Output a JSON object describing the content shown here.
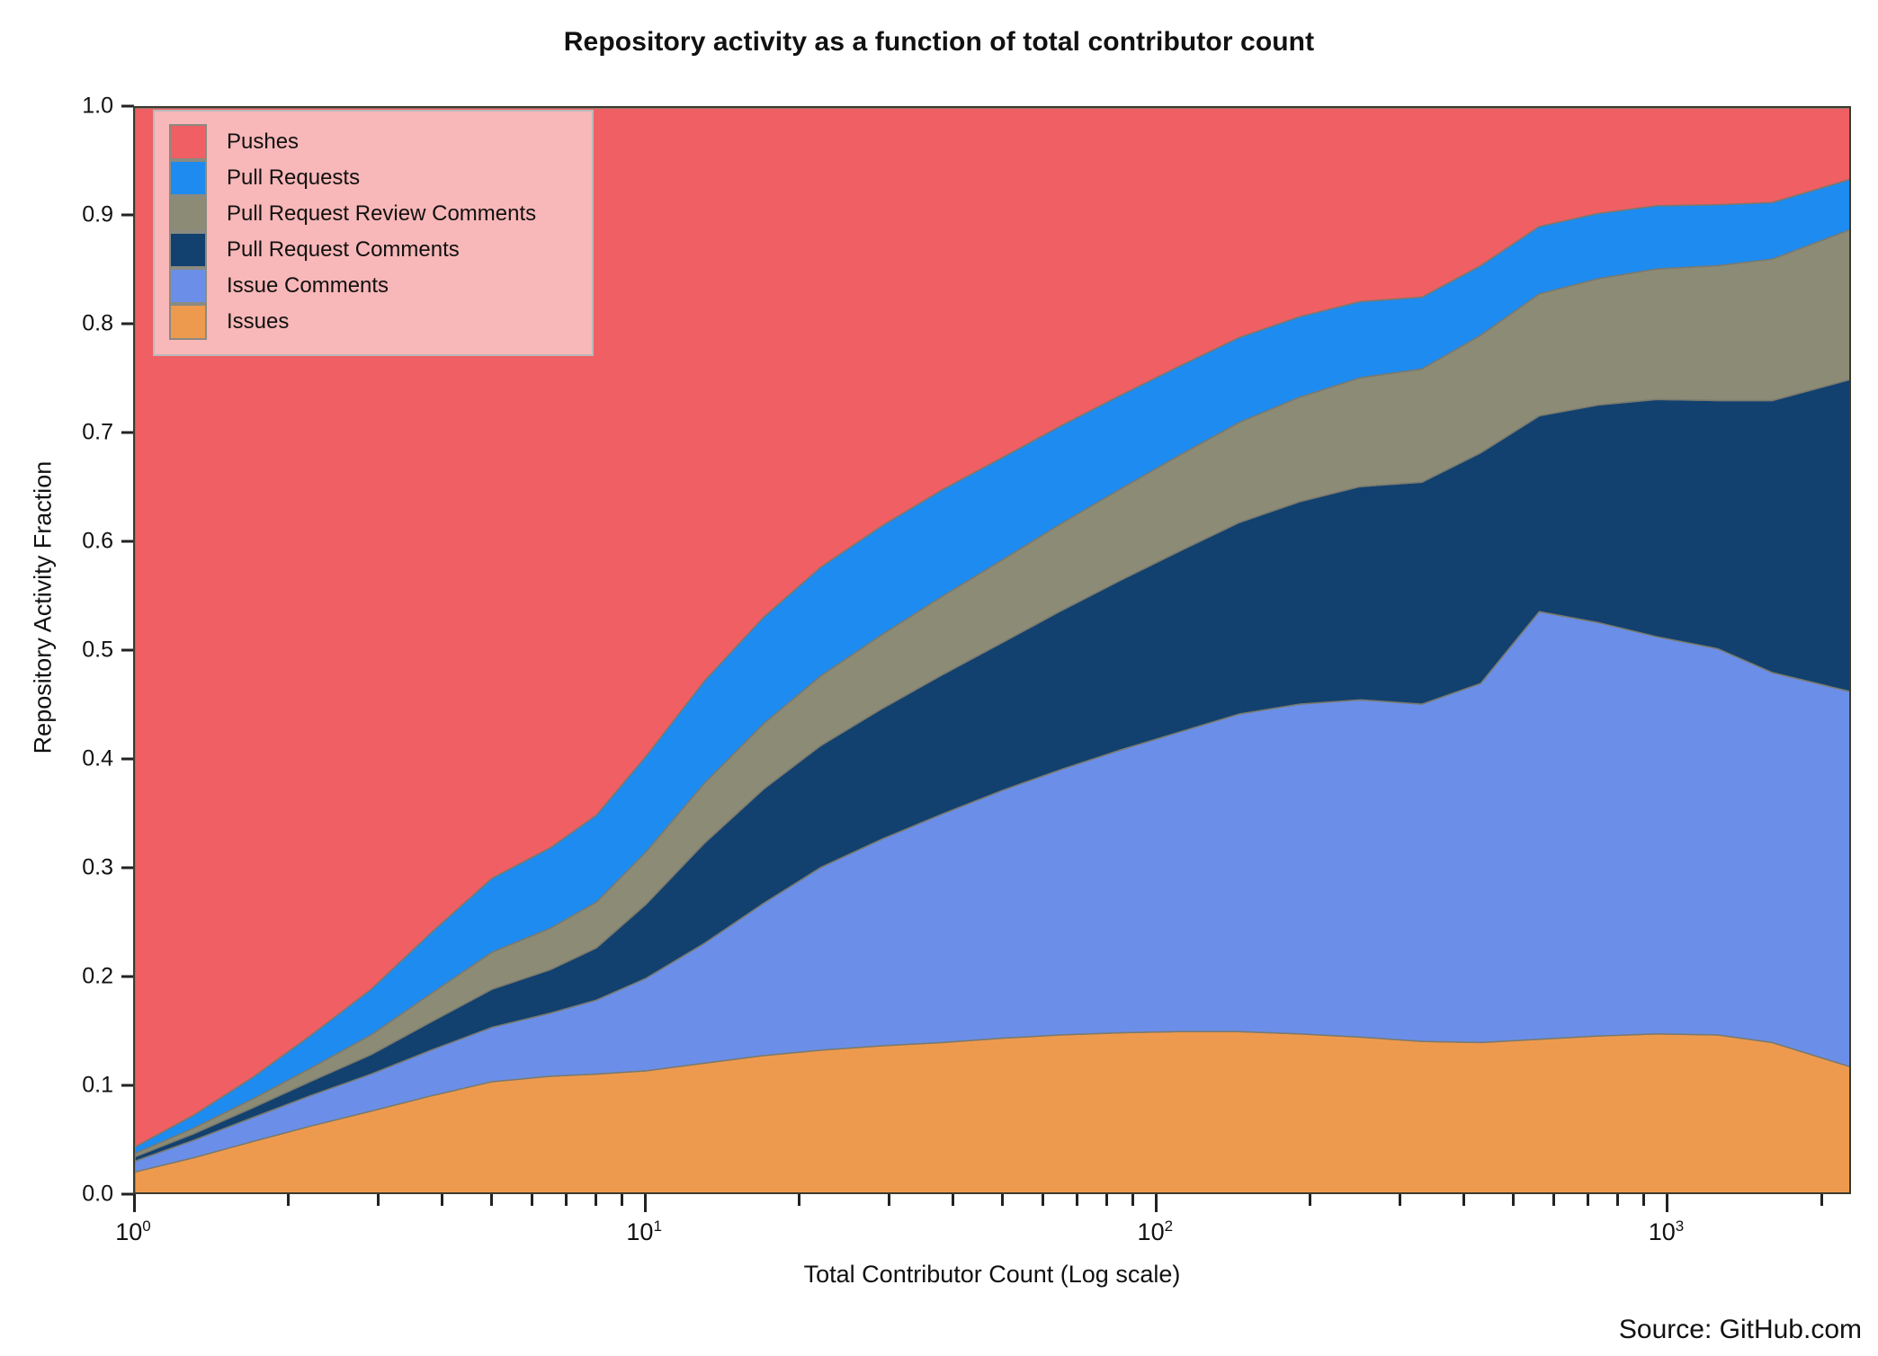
{
  "chart_data": {
    "type": "area",
    "title": "Repository activity as a function of total contributor count",
    "xlabel": "Total Contributor Count (Log scale)",
    "ylabel": "Repository Activity Fraction",
    "source": "Source: GitHub.com",
    "xscale": "log",
    "xlim": [
      1,
      2300
    ],
    "ylim": [
      0,
      1
    ],
    "grid": false,
    "stacked": true,
    "legend_position": "upper-left",
    "ytick_labels": [
      "0.0",
      "0.1",
      "0.2",
      "0.3",
      "0.4",
      "0.5",
      "0.6",
      "0.7",
      "0.8",
      "0.9",
      "1.0"
    ],
    "ytick_values": [
      0.0,
      0.1,
      0.2,
      0.3,
      0.4,
      0.5,
      0.6,
      0.7,
      0.8,
      0.9,
      1.0
    ],
    "xtick_labels": [
      "10⁰",
      "10¹",
      "10²",
      "10³"
    ],
    "xtick_values": [
      1,
      10,
      100,
      1000
    ],
    "xtick_exponents": [
      "0",
      "1",
      "2",
      "3"
    ],
    "x": [
      1,
      1.3,
      1.7,
      2.2,
      2.9,
      3.8,
      5,
      6.5,
      8,
      10,
      13,
      17,
      22,
      29,
      38,
      50,
      65,
      85,
      110,
      145,
      190,
      250,
      330,
      430,
      560,
      730,
      950,
      1250,
      1600,
      2300
    ],
    "series": [
      {
        "name": "Issues",
        "color": "#EE9A4E",
        "values": [
          0.022,
          0.035,
          0.05,
          0.064,
          0.078,
          0.092,
          0.105,
          0.11,
          0.112,
          0.115,
          0.122,
          0.129,
          0.134,
          0.138,
          0.141,
          0.145,
          0.148,
          0.15,
          0.151,
          0.151,
          0.149,
          0.146,
          0.142,
          0.141,
          0.144,
          0.147,
          0.149,
          0.148,
          0.141,
          0.118
        ]
      },
      {
        "name": "Issue Comments",
        "color": "#6B8FE8",
        "values": [
          0.01,
          0.016,
          0.022,
          0.028,
          0.034,
          0.042,
          0.05,
          0.058,
          0.068,
          0.085,
          0.11,
          0.14,
          0.168,
          0.19,
          0.21,
          0.228,
          0.244,
          0.26,
          0.275,
          0.292,
          0.303,
          0.31,
          0.31,
          0.33,
          0.393,
          0.38,
          0.365,
          0.355,
          0.34,
          0.345
        ]
      },
      {
        "name": "Pull Request Comments",
        "color": "#12416F",
        "values": [
          0.004,
          0.006,
          0.009,
          0.013,
          0.018,
          0.026,
          0.035,
          0.04,
          0.048,
          0.068,
          0.092,
          0.105,
          0.112,
          0.12,
          0.128,
          0.136,
          0.146,
          0.156,
          0.166,
          0.176,
          0.186,
          0.196,
          0.204,
          0.212,
          0.18,
          0.2,
          0.218,
          0.228,
          0.25,
          0.288
        ]
      },
      {
        "name": "Pull Request Review Comments",
        "color": "#8C8B76",
        "values": [
          0.003,
          0.005,
          0.008,
          0.012,
          0.018,
          0.026,
          0.034,
          0.038,
          0.042,
          0.048,
          0.055,
          0.06,
          0.064,
          0.068,
          0.072,
          0.076,
          0.08,
          0.084,
          0.088,
          0.092,
          0.096,
          0.1,
          0.104,
          0.108,
          0.112,
          0.116,
          0.12,
          0.124,
          0.13,
          0.138
        ]
      },
      {
        "name": "Pull Requests",
        "color": "#1E8BF0",
        "values": [
          0.006,
          0.012,
          0.02,
          0.03,
          0.042,
          0.056,
          0.068,
          0.074,
          0.08,
          0.088,
          0.094,
          0.098,
          0.1,
          0.1,
          0.098,
          0.094,
          0.09,
          0.086,
          0.082,
          0.078,
          0.074,
          0.07,
          0.066,
          0.064,
          0.062,
          0.06,
          0.058,
          0.056,
          0.052,
          0.046
        ]
      },
      {
        "name": "Pushes",
        "color": "#EF5F63",
        "values": [
          0.955,
          0.926,
          0.891,
          0.853,
          0.81,
          0.758,
          0.708,
          0.68,
          0.65,
          0.596,
          0.527,
          0.468,
          0.422,
          0.384,
          0.351,
          0.321,
          0.292,
          0.264,
          0.238,
          0.211,
          0.192,
          0.178,
          0.174,
          0.145,
          0.109,
          0.097,
          0.09,
          0.089,
          0.087,
          0.065
        ]
      }
    ]
  },
  "legend": {
    "items": [
      {
        "label": "Pushes",
        "color": "#EF5F63"
      },
      {
        "label": "Pull Requests",
        "color": "#1E8BF0"
      },
      {
        "label": "Pull Request Review Comments",
        "color": "#8C8B76"
      },
      {
        "label": "Pull Request Comments",
        "color": "#12416F"
      },
      {
        "label": "Issue Comments",
        "color": "#6B8FE8"
      },
      {
        "label": "Issues",
        "color": "#EE9A4E"
      }
    ]
  }
}
